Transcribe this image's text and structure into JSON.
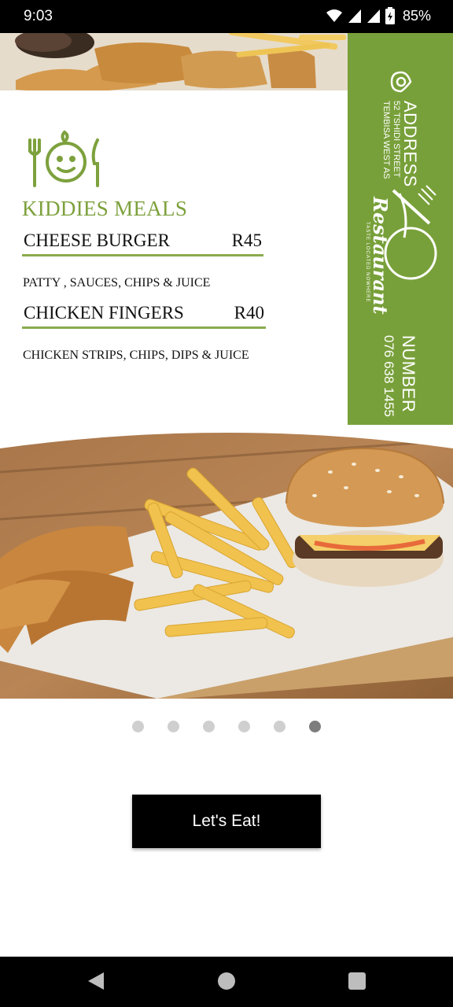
{
  "status_bar": {
    "time": "9:03",
    "battery": "85%",
    "icons": [
      "wifi-icon",
      "signal-icon",
      "signal-icon",
      "battery-icon"
    ]
  },
  "menu": {
    "address_heading": "ADDRESS",
    "address_line1": "52 TSHIDI STREET",
    "address_line2": "TEMBISA WEST AS",
    "logo_text": "Restaurant",
    "logo_tagline": "TASTE LOCATED NOWHERE",
    "number_heading": "NUMBER",
    "number_value": "076 638 1455",
    "section_title": "KIDDIES MEALS",
    "items": [
      {
        "name": "CHEESE BURGER",
        "price": "R45",
        "description": "PATTY , SAUCES, CHIPS & JUICE"
      },
      {
        "name": "CHICKEN FINGERS",
        "price": "R40",
        "description": "CHICKEN STRIPS, CHIPS, DIPS & JUICE"
      }
    ],
    "colors": {
      "brand_green": "#78a03a",
      "title_green": "#7da13d"
    }
  },
  "pager": {
    "count": 6,
    "active_index": 5
  },
  "cta": {
    "label": "Let's Eat!"
  },
  "nav": {
    "icons": [
      "back-icon",
      "home-icon",
      "recents-icon"
    ]
  }
}
